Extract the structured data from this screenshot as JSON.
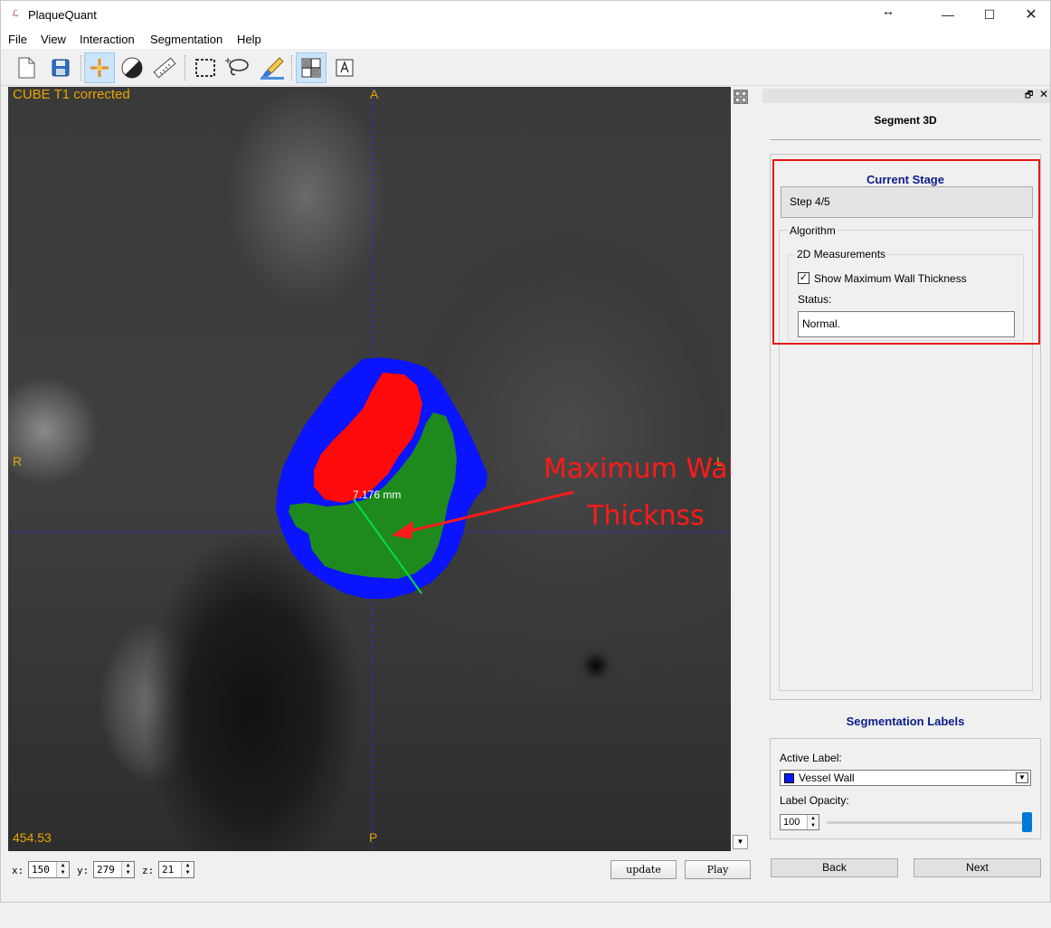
{
  "app": {
    "title": "PlaqueQuant"
  },
  "menu": {
    "items": [
      "File",
      "View",
      "Interaction",
      "Segmentation",
      "Help"
    ]
  },
  "viewer": {
    "title": "CUBE T1 corrected",
    "orientation": {
      "top": "A",
      "bottom": "P",
      "left": "R",
      "right": "L"
    },
    "window_value": "454.53",
    "measurement": "7.176 mm",
    "annotation_line1": "Maximum Wall",
    "annotation_line2": "Thicknss",
    "colors": {
      "vessel_wall": "#0a14ff",
      "lumen": "#ff0a0a",
      "plaque": "#1e8a1e",
      "measure_line": "#00e040",
      "annotation": "#ff1a1a",
      "overlay_text": "#e8a400"
    }
  },
  "coords": {
    "x_label": "x:",
    "x": "150",
    "y_label": "y:",
    "y": "279",
    "z_label": "z:",
    "z": "21"
  },
  "buttons": {
    "update": "update",
    "play": "Play",
    "back": "Back",
    "next": "Next"
  },
  "panel": {
    "heading": "Segment 3D",
    "current_stage_title": "Current Stage",
    "step": "Step 4/5",
    "algorithm_title": "Algorithm",
    "measurements_title": "2D Measurements",
    "show_max_wall": "Show Maximum Wall Thickness",
    "show_max_wall_checked": true,
    "status_label": "Status:",
    "status_value": "Normal.",
    "seg_labels_title": "Segmentation Labels",
    "active_label_title": "Active Label:",
    "active_label_value": "Vessel Wall",
    "active_label_color": "#0a1aff",
    "label_opacity_title": "Label Opacity:",
    "label_opacity_value": "100"
  }
}
